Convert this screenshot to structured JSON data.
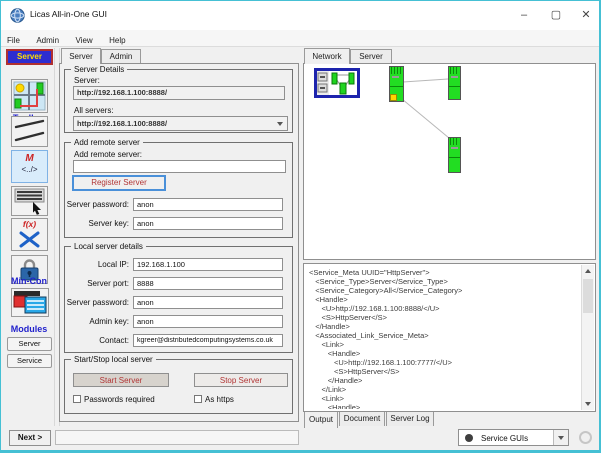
{
  "window": {
    "title": "Licas All-in-One GUI",
    "controls": {
      "minimize": "–",
      "maximize": "▢",
      "close": "✕"
    }
  },
  "menu": {
    "items": [
      "File",
      "Admin",
      "View",
      "Help"
    ]
  },
  "sidebar": {
    "server_button": "Server",
    "toolbar_label": "Toolbar",
    "min_con_label": "Min-Con",
    "modules_label": "Modules",
    "module_server_button": "Server",
    "module_service_button": "Service",
    "toolbar_icons": [
      "network-view-icon",
      "links-icon",
      "metadata-icon",
      "console-icon",
      "functions-icon",
      "lock-icon"
    ],
    "min_con_icon": "windows-icon",
    "metadata_icon_text": {
      "line1": "M",
      "line2": "<../>"
    },
    "functions_icon_text": "f(x)"
  },
  "center": {
    "tabs": [
      "Server",
      "Admin"
    ],
    "server_details": {
      "legend": "Server Details",
      "server_label": "Server:",
      "server_value": "http://192.168.1.100:8888/",
      "all_servers_label": "All servers:",
      "all_servers_value": "http://192.168.1.100:8888/"
    },
    "add_remote": {
      "legend": "Add remote server",
      "field_label": "Add remote server:",
      "field_value": "",
      "register_button": "Register Server",
      "password_label": "Server password:",
      "password_value": "anon",
      "key_label": "Server key:",
      "key_value": "anon"
    },
    "local_details": {
      "legend": "Local server details",
      "rows": [
        {
          "label": "Local IP:",
          "value": "192.168.1.100"
        },
        {
          "label": "Server port:",
          "value": "8888"
        },
        {
          "label": "Server password:",
          "value": "anon"
        },
        {
          "label": "Admin key:",
          "value": "anon"
        },
        {
          "label": "Contact:",
          "value": "kgreer@distributedcomputingsystems.co.uk"
        }
      ]
    },
    "start_stop": {
      "legend": "Start/Stop local server",
      "start_button": "Start Server",
      "stop_button": "Stop Server",
      "passwords_checkbox": "Passwords required",
      "https_checkbox": "As https"
    }
  },
  "right": {
    "tabs": [
      "Network",
      "Server"
    ],
    "network_diagram": {
      "node_count": 3,
      "link_count": 2,
      "node_color": "#22dd22",
      "flag_color": "#ffd400"
    },
    "xml": {
      "lines": [
        "<Service_Meta UUID=\"HttpServer\">",
        "   <Service_Type>Server</Service_Type>",
        "   <Service_Category>All</Service_Category>",
        "   <Handle>",
        "      <U>http://192.168.1.100:8888/</U>",
        "      <S>HttpServer</S>",
        "   </Handle>",
        "   <Associated_Link_Service_Meta>",
        "      <Link>",
        "         <Handle>",
        "            <U>http://192.168.1.100:7777/</U>",
        "            <S>HttpServer</S>",
        "         </Handle>",
        "      </Link>",
        "      <Link>",
        "         <Handle>"
      ]
    },
    "output_tabs": [
      "Output",
      "Document",
      "Server Log"
    ]
  },
  "bottom": {
    "next_button": "Next >",
    "status_value": "",
    "service_guis": "Service GUIs"
  },
  "colors": {
    "window_border": "#45c0d4",
    "accent_blue": "#2222cc",
    "server_button_bg": "#2d2dd0",
    "server_button_text": "#ffe000",
    "red_button_text": "#b13535",
    "node_green": "#22dd22",
    "flag_yellow": "#ffd400"
  }
}
